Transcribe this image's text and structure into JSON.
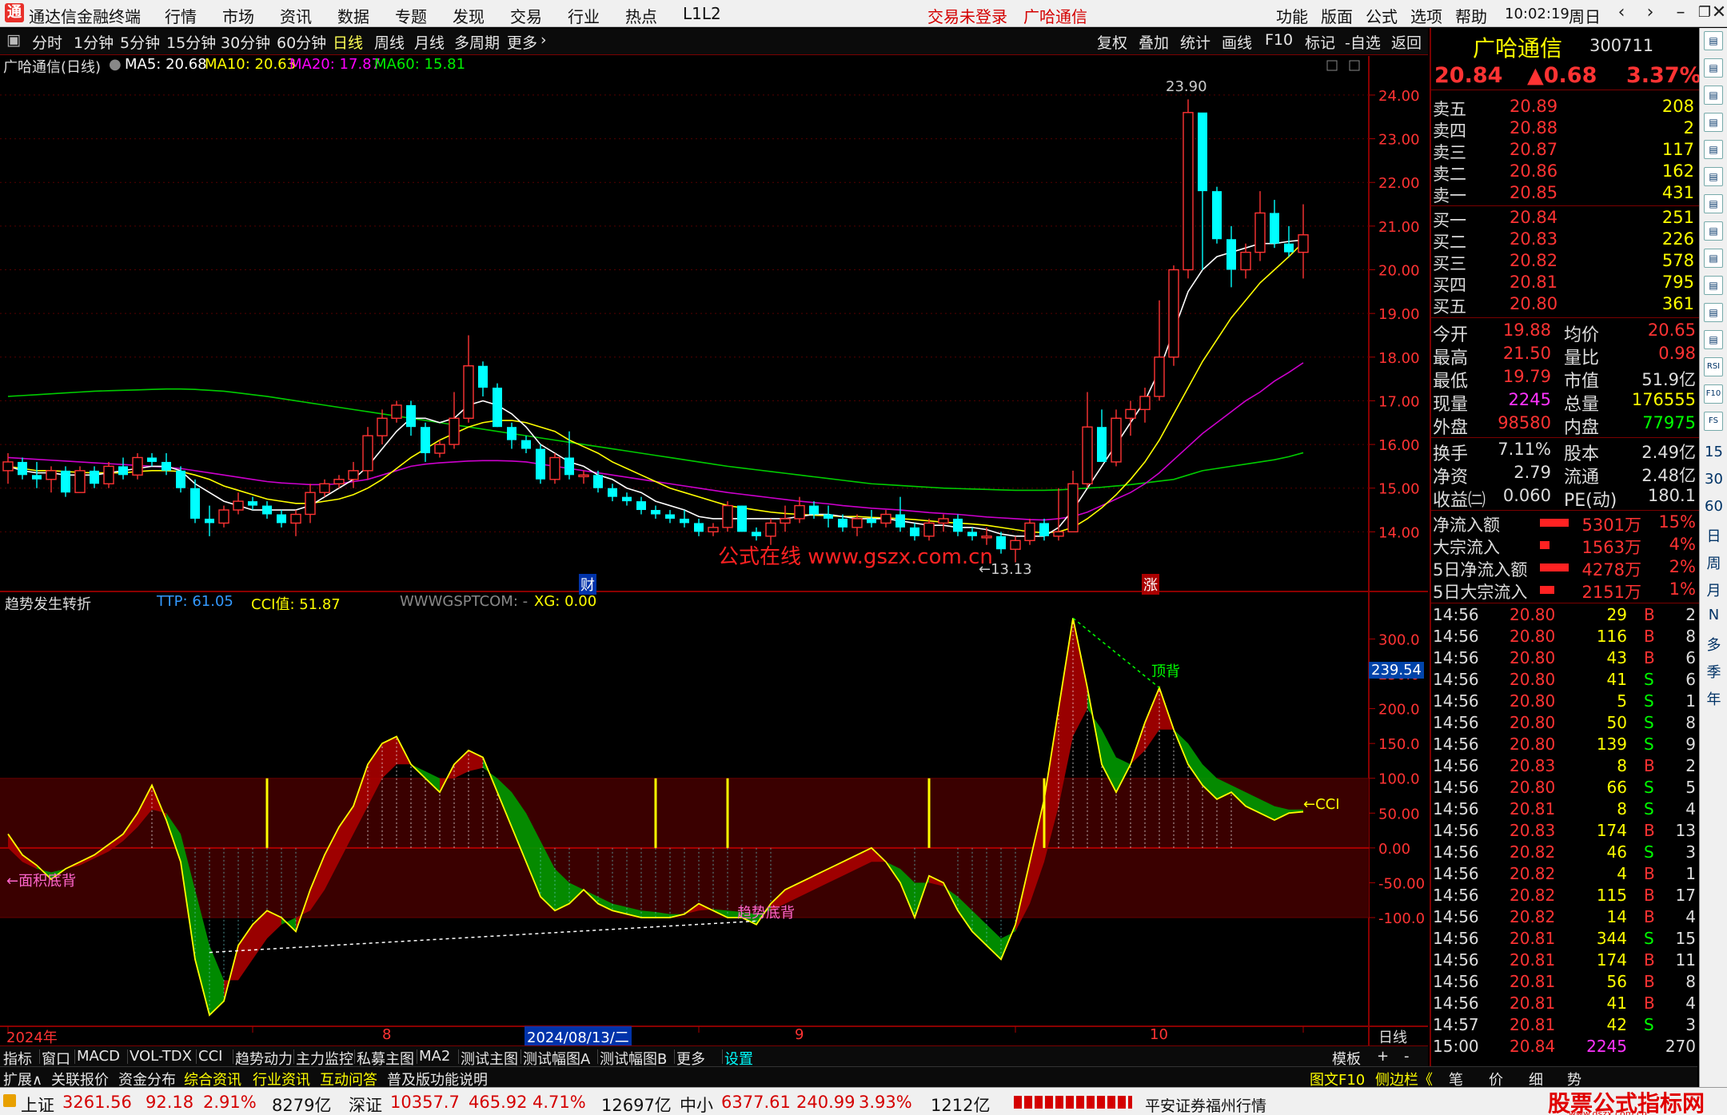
{
  "titlebar": {
    "app_title": "通达信金融终端",
    "menu": [
      "行情",
      "市场",
      "资讯",
      "数据",
      "专题",
      "发现",
      "交易",
      "行业",
      "热点",
      "L1L2"
    ],
    "trade_status": "交易未登录",
    "stock_name": "广哈通信",
    "right_menu": [
      "功能",
      "版面",
      "公式",
      "选项",
      "帮助"
    ],
    "time": "10:02:19",
    "weekday": "周日"
  },
  "toolbar": {
    "periods": [
      "分时",
      "1分钟",
      "5分钟",
      "15分钟",
      "30分钟",
      "60分钟",
      "日线",
      "周线",
      "月线",
      "多周期",
      "更多"
    ],
    "active_period": "日线",
    "right_buttons": [
      "复权",
      "叠加",
      "统计",
      "画线",
      "F10",
      "标记",
      "-自选",
      "返回"
    ]
  },
  "main_chart": {
    "title": "广哈通信(日线)",
    "ma5": "MA5: 20.68",
    "ma10": "MA10: 20.63",
    "ma20": "MA20: 17.87",
    "ma60": "MA60: 15.81",
    "high_label": "23.90",
    "low_label": "←13.13",
    "fin_marker": "财",
    "rise_marker": "涨",
    "watermark": "公式在线 www.gszx.com.cn",
    "y_ticks": [
      "24.00",
      "23.00",
      "22.00",
      "21.00",
      "20.00",
      "19.00",
      "18.00",
      "17.00",
      "16.00",
      "15.00",
      "14.00"
    ]
  },
  "indicator": {
    "title": "趋势发生转折",
    "ttp": "TTP: 61.05",
    "cci_value": "CCI值: 51.87",
    "site": "WWWGSPTCOM: -",
    "xg": "XG: 0.00",
    "y_ticks": [
      "300.0",
      "250.0",
      "200.0",
      "150.0",
      "100.0",
      "50.00",
      "0.00",
      "-50.00",
      "-100.0"
    ],
    "current_value": "239.54",
    "label_area": "←面积底背",
    "label_trend": "趋势底背",
    "label_top": "顶背",
    "label_cci": "←CCI"
  },
  "x_axis": {
    "labels": [
      "2024年",
      "8",
      "2024/08/13/二",
      "9",
      "10"
    ],
    "period_label": "日线"
  },
  "chart_data": {
    "type": "candlestick",
    "price_axis": {
      "min": 13.0,
      "max": 24.2
    },
    "cci_axis": {
      "min": -240,
      "max": 320
    },
    "candles": [
      [
        15.4,
        15.8,
        15.1,
        15.6
      ],
      [
        15.6,
        15.7,
        15.2,
        15.3
      ],
      [
        15.3,
        15.6,
        15.0,
        15.2
      ],
      [
        15.2,
        15.5,
        14.9,
        15.4
      ],
      [
        15.4,
        15.5,
        14.8,
        14.9
      ],
      [
        14.9,
        15.5,
        14.9,
        15.4
      ],
      [
        15.4,
        15.5,
        15.0,
        15.1
      ],
      [
        15.1,
        15.6,
        15.0,
        15.5
      ],
      [
        15.5,
        15.7,
        15.2,
        15.3
      ],
      [
        15.3,
        15.8,
        15.2,
        15.7
      ],
      [
        15.7,
        15.8,
        15.5,
        15.6
      ],
      [
        15.6,
        15.8,
        15.3,
        15.4
      ],
      [
        15.4,
        15.5,
        14.9,
        15.0
      ],
      [
        15.0,
        15.2,
        14.2,
        14.3
      ],
      [
        14.3,
        14.6,
        13.9,
        14.2
      ],
      [
        14.2,
        14.6,
        14.1,
        14.5
      ],
      [
        14.5,
        14.9,
        14.4,
        14.7
      ],
      [
        14.7,
        14.8,
        14.5,
        14.6
      ],
      [
        14.6,
        14.7,
        14.3,
        14.4
      ],
      [
        14.4,
        14.5,
        14.1,
        14.2
      ],
      [
        14.2,
        14.5,
        13.9,
        14.4
      ],
      [
        14.4,
        15.1,
        14.2,
        14.9
      ],
      [
        14.9,
        15.2,
        14.8,
        15.1
      ],
      [
        15.1,
        15.3,
        15.0,
        15.2
      ],
      [
        15.2,
        15.6,
        15.0,
        15.4
      ],
      [
        15.4,
        16.4,
        15.2,
        16.2
      ],
      [
        16.2,
        16.8,
        16.0,
        16.6
      ],
      [
        16.6,
        17.0,
        16.5,
        16.9
      ],
      [
        16.9,
        17.0,
        16.2,
        16.4
      ],
      [
        16.4,
        16.5,
        15.6,
        15.8
      ],
      [
        15.8,
        16.1,
        15.7,
        16.0
      ],
      [
        16.0,
        17.2,
        15.9,
        16.6
      ],
      [
        16.6,
        18.5,
        16.5,
        17.8
      ],
      [
        17.8,
        17.9,
        17.1,
        17.3
      ],
      [
        17.3,
        17.4,
        16.4,
        16.4
      ],
      [
        16.4,
        16.5,
        15.9,
        16.1
      ],
      [
        16.1,
        16.2,
        15.8,
        15.9
      ],
      [
        15.9,
        16.0,
        15.1,
        15.2
      ],
      [
        15.2,
        15.8,
        15.1,
        15.7
      ],
      [
        15.7,
        16.3,
        15.2,
        15.3
      ],
      [
        15.3,
        15.4,
        15.1,
        15.3
      ],
      [
        15.3,
        15.4,
        14.9,
        15.0
      ],
      [
        15.0,
        15.1,
        14.7,
        14.8
      ],
      [
        14.8,
        14.9,
        14.6,
        14.7
      ],
      [
        14.7,
        14.8,
        14.4,
        14.5
      ],
      [
        14.5,
        14.6,
        14.3,
        14.4
      ],
      [
        14.4,
        14.5,
        14.2,
        14.3
      ],
      [
        14.3,
        14.5,
        14.1,
        14.2
      ],
      [
        14.2,
        14.3,
        13.9,
        14.0
      ],
      [
        14.0,
        14.2,
        13.9,
        14.1
      ],
      [
        14.1,
        14.7,
        14.0,
        14.6
      ],
      [
        14.6,
        14.6,
        14.0,
        14.0
      ],
      [
        14.0,
        14.1,
        13.8,
        13.9
      ],
      [
        13.9,
        14.3,
        13.7,
        14.2
      ],
      [
        14.2,
        14.6,
        14.0,
        14.3
      ],
      [
        14.3,
        14.8,
        14.2,
        14.6
      ],
      [
        14.6,
        14.7,
        14.3,
        14.4
      ],
      [
        14.4,
        14.6,
        14.1,
        14.3
      ],
      [
        14.3,
        14.4,
        14.0,
        14.1
      ],
      [
        14.1,
        14.4,
        13.9,
        14.3
      ],
      [
        14.3,
        14.5,
        14.1,
        14.2
      ],
      [
        14.2,
        14.5,
        14.1,
        14.4
      ],
      [
        14.4,
        14.8,
        14.0,
        14.1
      ],
      [
        14.1,
        14.2,
        13.8,
        13.9
      ],
      [
        13.9,
        14.3,
        13.8,
        14.2
      ],
      [
        14.2,
        14.4,
        14.0,
        14.3
      ],
      [
        14.3,
        14.4,
        13.9,
        14.0
      ],
      [
        14.0,
        14.1,
        13.8,
        13.9
      ],
      [
        13.9,
        14.1,
        13.7,
        13.9
      ],
      [
        13.9,
        14.0,
        13.5,
        13.6
      ],
      [
        13.6,
        13.9,
        13.3,
        13.8
      ],
      [
        13.8,
        14.3,
        13.7,
        14.2
      ],
      [
        14.2,
        14.3,
        13.8,
        13.9
      ],
      [
        13.9,
        15.0,
        13.8,
        14.0
      ],
      [
        14.0,
        15.4,
        14.0,
        15.1
      ],
      [
        15.1,
        17.2,
        15.0,
        16.4
      ],
      [
        16.4,
        16.8,
        15.8,
        15.6
      ],
      [
        15.6,
        16.8,
        15.5,
        16.6
      ],
      [
        16.6,
        17.0,
        16.2,
        16.8
      ],
      [
        16.8,
        17.3,
        16.5,
        17.1
      ],
      [
        17.1,
        19.3,
        17.0,
        18.0
      ],
      [
        18.0,
        20.1,
        17.8,
        20.0
      ],
      [
        20.0,
        23.9,
        19.8,
        23.6
      ],
      [
        23.6,
        23.1,
        20.0,
        21.8
      ],
      [
        21.8,
        21.9,
        20.6,
        20.7
      ],
      [
        20.7,
        21.0,
        19.6,
        20.0
      ],
      [
        20.0,
        20.6,
        19.8,
        20.4
      ],
      [
        20.4,
        21.8,
        20.2,
        21.3
      ],
      [
        21.3,
        21.6,
        20.5,
        20.6
      ],
      [
        20.6,
        21.0,
        20.3,
        20.4
      ],
      [
        20.4,
        21.5,
        19.8,
        20.8
      ]
    ],
    "ma5": [
      15.5,
      15.4,
      15.35,
      15.35,
      15.3,
      15.3,
      15.3,
      15.35,
      15.4,
      15.45,
      15.5,
      15.5,
      15.4,
      15.1,
      14.9,
      14.7,
      14.6,
      14.5,
      14.5,
      14.5,
      14.5,
      14.6,
      14.8,
      15.0,
      15.2,
      15.5,
      15.9,
      16.3,
      16.6,
      16.6,
      16.5,
      16.6,
      16.9,
      17.0,
      16.9,
      16.7,
      16.4,
      16.0,
      15.8,
      15.6,
      15.5,
      15.3,
      15.2,
      15.0,
      14.9,
      14.7,
      14.6,
      14.5,
      14.35,
      14.3,
      14.3,
      14.3,
      14.3,
      14.3,
      14.3,
      14.35,
      14.4,
      14.4,
      14.35,
      14.3,
      14.3,
      14.3,
      14.25,
      14.2,
      14.15,
      14.15,
      14.1,
      14.1,
      14.05,
      13.95,
      13.9,
      13.9,
      13.9,
      14.1,
      14.5,
      15.0,
      15.5,
      16.0,
      16.5,
      17.0,
      17.7,
      18.6,
      19.5,
      20.0,
      20.3,
      20.4,
      20.5,
      20.6,
      20.6,
      20.65,
      20.68
    ],
    "ma10": [
      15.5,
      15.45,
      15.4,
      15.4,
      15.38,
      15.36,
      15.35,
      15.35,
      15.35,
      15.38,
      15.4,
      15.4,
      15.38,
      15.3,
      15.2,
      15.05,
      14.95,
      14.85,
      14.75,
      14.7,
      14.65,
      14.65,
      14.7,
      14.75,
      14.85,
      15.0,
      15.2,
      15.45,
      15.7,
      15.9,
      16.1,
      16.25,
      16.4,
      16.5,
      16.55,
      16.55,
      16.5,
      16.4,
      16.3,
      16.1,
      15.95,
      15.8,
      15.6,
      15.45,
      15.3,
      15.15,
      15.0,
      14.9,
      14.8,
      14.7,
      14.6,
      14.55,
      14.5,
      14.45,
      14.42,
      14.4,
      14.38,
      14.37,
      14.35,
      14.35,
      14.33,
      14.32,
      14.3,
      14.28,
      14.25,
      14.22,
      14.2,
      14.18,
      14.15,
      14.1,
      14.05,
      14.0,
      13.98,
      14.0,
      14.1,
      14.3,
      14.55,
      14.85,
      15.2,
      15.6,
      16.1,
      16.7,
      17.3,
      17.9,
      18.4,
      18.9,
      19.3,
      19.7,
      20.0,
      20.3,
      20.63
    ],
    "ma20": [
      15.7,
      15.68,
      15.66,
      15.64,
      15.62,
      15.6,
      15.58,
      15.56,
      15.54,
      15.52,
      15.5,
      15.48,
      15.45,
      15.4,
      15.35,
      15.3,
      15.25,
      15.2,
      15.15,
      15.12,
      15.1,
      15.08,
      15.08,
      15.1,
      15.15,
      15.2,
      15.3,
      15.4,
      15.5,
      15.55,
      15.58,
      15.6,
      15.62,
      15.63,
      15.63,
      15.62,
      15.6,
      15.55,
      15.5,
      15.45,
      15.4,
      15.35,
      15.3,
      15.25,
      15.2,
      15.15,
      15.1,
      15.05,
      15.0,
      14.95,
      14.9,
      14.86,
      14.82,
      14.78,
      14.74,
      14.7,
      14.67,
      14.64,
      14.6,
      14.57,
      14.54,
      14.52,
      14.5,
      14.47,
      14.44,
      14.42,
      14.4,
      14.37,
      14.34,
      14.32,
      14.3,
      14.28,
      14.27,
      14.3,
      14.35,
      14.45,
      14.6,
      14.75,
      14.9,
      15.1,
      15.35,
      15.65,
      15.95,
      16.25,
      16.5,
      16.75,
      17.0,
      17.2,
      17.45,
      17.65,
      17.87
    ],
    "ma60": [
      17.1,
      17.12,
      17.14,
      17.16,
      17.18,
      17.2,
      17.22,
      17.23,
      17.24,
      17.25,
      17.26,
      17.27,
      17.27,
      17.26,
      17.24,
      17.22,
      17.18,
      17.14,
      17.1,
      17.05,
      17.0,
      16.95,
      16.9,
      16.85,
      16.8,
      16.75,
      16.7,
      16.65,
      16.6,
      16.55,
      16.5,
      16.45,
      16.4,
      16.35,
      16.3,
      16.25,
      16.2,
      16.15,
      16.1,
      16.05,
      16.0,
      15.95,
      15.9,
      15.85,
      15.8,
      15.75,
      15.7,
      15.65,
      15.6,
      15.55,
      15.5,
      15.46,
      15.42,
      15.38,
      15.34,
      15.3,
      15.26,
      15.22,
      15.18,
      15.14,
      15.1,
      15.08,
      15.06,
      15.04,
      15.02,
      15.0,
      14.99,
      14.98,
      14.97,
      14.96,
      14.95,
      14.95,
      14.95,
      14.96,
      14.98,
      15.0,
      15.02,
      15.05,
      15.08,
      15.12,
      15.16,
      15.2,
      15.3,
      15.4,
      15.45,
      15.5,
      15.55,
      15.6,
      15.65,
      15.72,
      15.81
    ],
    "cci": [
      20,
      -10,
      -25,
      -45,
      -30,
      -20,
      -10,
      5,
      20,
      50,
      90,
      40,
      -20,
      -160,
      -240,
      -220,
      -140,
      -110,
      -90,
      -100,
      -120,
      -60,
      -10,
      30,
      60,
      120,
      150,
      160,
      120,
      100,
      80,
      120,
      140,
      130,
      80,
      30,
      -20,
      -70,
      -90,
      -80,
      -60,
      -80,
      -90,
      -95,
      -100,
      -100,
      -100,
      -95,
      -80,
      -90,
      -100,
      -100,
      -110,
      -80,
      -60,
      -50,
      -40,
      -30,
      -20,
      -10,
      0,
      -20,
      -50,
      -100,
      -40,
      -50,
      -90,
      -120,
      -140,
      -160,
      -110,
      -20,
      70,
      200,
      330,
      230,
      120,
      80,
      120,
      180,
      230,
      170,
      120,
      90,
      70,
      80,
      60,
      50,
      40,
      50,
      52
    ],
    "cci_ma": [
      0,
      -20,
      -30,
      -35,
      -30,
      -25,
      -15,
      -5,
      10,
      30,
      55,
      50,
      20,
      -60,
      -140,
      -190,
      -190,
      -160,
      -130,
      -110,
      -100,
      -90,
      -60,
      -20,
      20,
      60,
      100,
      120,
      120,
      110,
      100,
      100,
      110,
      115,
      100,
      80,
      50,
      10,
      -30,
      -50,
      -60,
      -70,
      -80,
      -85,
      -90,
      -92,
      -95,
      -95,
      -90,
      -88,
      -90,
      -92,
      -95,
      -90,
      -80,
      -70,
      -60,
      -50,
      -40,
      -30,
      -20,
      -20,
      -30,
      -50,
      -50,
      -55,
      -70,
      -90,
      -110,
      -130,
      -120,
      -80,
      -20,
      60,
      160,
      200,
      170,
      130,
      120,
      140,
      170,
      170,
      150,
      120,
      100,
      90,
      80,
      70,
      60,
      55,
      55
    ]
  },
  "quote": {
    "name": "广哈通信",
    "code": "300711",
    "price": "20.84",
    "change": "▲0.68",
    "pct": "3.37%",
    "sells": [
      [
        "卖五",
        "20.89",
        "208"
      ],
      [
        "卖四",
        "20.88",
        "2"
      ],
      [
        "卖三",
        "20.87",
        "117"
      ],
      [
        "卖二",
        "20.86",
        "162"
      ],
      [
        "卖一",
        "20.85",
        "431"
      ]
    ],
    "buys": [
      [
        "买一",
        "20.84",
        "251"
      ],
      [
        "买二",
        "20.83",
        "226"
      ],
      [
        "买三",
        "20.82",
        "578"
      ],
      [
        "买四",
        "20.81",
        "795"
      ],
      [
        "买五",
        "20.80",
        "361"
      ]
    ],
    "stats1": [
      [
        "今开",
        "19.88",
        "均价",
        "20.65"
      ],
      [
        "最高",
        "21.50",
        "量比",
        "0.98"
      ],
      [
        "最低",
        "19.79",
        "市值",
        "51.9亿"
      ],
      [
        "现量",
        "2245",
        "总量",
        "176555"
      ],
      [
        "外盘",
        "98580",
        "内盘",
        "77975"
      ]
    ],
    "stats2": [
      [
        "换手",
        "7.11%",
        "股本",
        "2.49亿"
      ],
      [
        "净资",
        "2.79",
        "流通",
        "2.48亿"
      ],
      [
        "收益㈡",
        "0.060",
        "PE(动)",
        "180.1"
      ]
    ],
    "flows": [
      [
        "净流入额",
        "5301万",
        "15%"
      ],
      [
        "大宗流入",
        "1563万",
        "4%"
      ],
      [
        "5日净流入额",
        "4278万",
        "2%"
      ],
      [
        "5日大宗流入",
        "2151万",
        "1%"
      ]
    ],
    "ticks": [
      [
        "14:56",
        "20.80",
        "29",
        "B",
        "2"
      ],
      [
        "14:56",
        "20.80",
        "116",
        "B",
        "8"
      ],
      [
        "14:56",
        "20.80",
        "43",
        "B",
        "6"
      ],
      [
        "14:56",
        "20.80",
        "41",
        "S",
        "6"
      ],
      [
        "14:56",
        "20.80",
        "5",
        "S",
        "1"
      ],
      [
        "14:56",
        "20.80",
        "50",
        "S",
        "8"
      ],
      [
        "14:56",
        "20.80",
        "139",
        "S",
        "9"
      ],
      [
        "14:56",
        "20.83",
        "8",
        "B",
        "2"
      ],
      [
        "14:56",
        "20.80",
        "66",
        "S",
        "5"
      ],
      [
        "14:56",
        "20.81",
        "8",
        "S",
        "4"
      ],
      [
        "14:56",
        "20.83",
        "174",
        "B",
        "13"
      ],
      [
        "14:56",
        "20.82",
        "46",
        "S",
        "3"
      ],
      [
        "14:56",
        "20.82",
        "4",
        "B",
        "1"
      ],
      [
        "14:56",
        "20.82",
        "115",
        "B",
        "17"
      ],
      [
        "14:56",
        "20.82",
        "14",
        "B",
        "4"
      ],
      [
        "14:56",
        "20.81",
        "344",
        "S",
        "15"
      ],
      [
        "14:56",
        "20.81",
        "174",
        "B",
        "11"
      ],
      [
        "14:56",
        "20.81",
        "56",
        "B",
        "8"
      ],
      [
        "14:56",
        "20.81",
        "41",
        "B",
        "4"
      ],
      [
        "14:57",
        "20.81",
        "42",
        "S",
        "3"
      ],
      [
        "15:00",
        "20.84",
        "2245",
        "",
        "270"
      ]
    ]
  },
  "far_right": {
    "icons": [
      "RSI",
      "F10",
      "FS"
    ],
    "periods": [
      "15",
      "30",
      "60",
      "日",
      "周",
      "月",
      "N",
      "多",
      "季",
      "年"
    ]
  },
  "tabs1": [
    "指标",
    "窗口",
    "MACD",
    "VOL-TDX",
    "CCI",
    "趋势动力",
    "主力监控",
    "私募主图",
    "MA2",
    "测试主图",
    "测试幅图A",
    "测试幅图B",
    "更多",
    "设置",
    "模板",
    "+",
    "-"
  ],
  "tabs2": [
    "扩展∧",
    "关联报价",
    "资金分布",
    "综合资讯",
    "行业资讯",
    "互动问答",
    "普及版功能说明"
  ],
  "tabs2_right": [
    "图文F10",
    "侧边栏《",
    "笔",
    "价",
    "细",
    "势"
  ],
  "status": {
    "sh_label": "上证",
    "sh_val": "3261.56",
    "sh_chg": "92.18",
    "sh_pct": "2.91%",
    "sh_amt": "8279亿",
    "sz_label": "深证",
    "sz_val": "10357.7",
    "sz_chg": "465.92",
    "sz_pct": "4.71%",
    "sz_amt": "12697亿",
    "zx_label": "中小",
    "zx_val": "6377.61",
    "zx_chg": "240.99",
    "zx_pct": "3.93%",
    "zx_amt": "1212亿",
    "broker": "平安证券福州行情",
    "brand": "股票公式指标网",
    "brand_url": "www.gszx.com.cn"
  }
}
